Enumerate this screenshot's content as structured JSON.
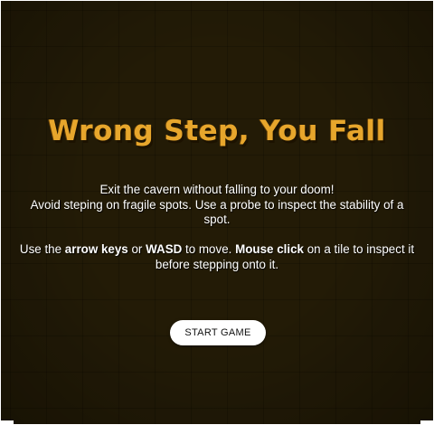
{
  "title": "Wrong Step, You Fall",
  "instructions": {
    "line1": "Exit the cavern without falling to your doom!",
    "line2": "Avoid steping on fragile spots. Use a probe to inspect the stability of a spot.",
    "line3_pre": "Use the ",
    "line3_keys": "arrow keys",
    "line3_or": " or ",
    "line3_wasd": "WASD",
    "line3_move": " to move. ",
    "line3_click": "Mouse click",
    "line3_post": " on a tile to inspect it before stepping onto it."
  },
  "start_button": {
    "label": "START GAME"
  },
  "colors": {
    "background": "#2b2209",
    "title": "#e7a62c",
    "text": "#ffffff",
    "button_bg": "#ffffff"
  }
}
